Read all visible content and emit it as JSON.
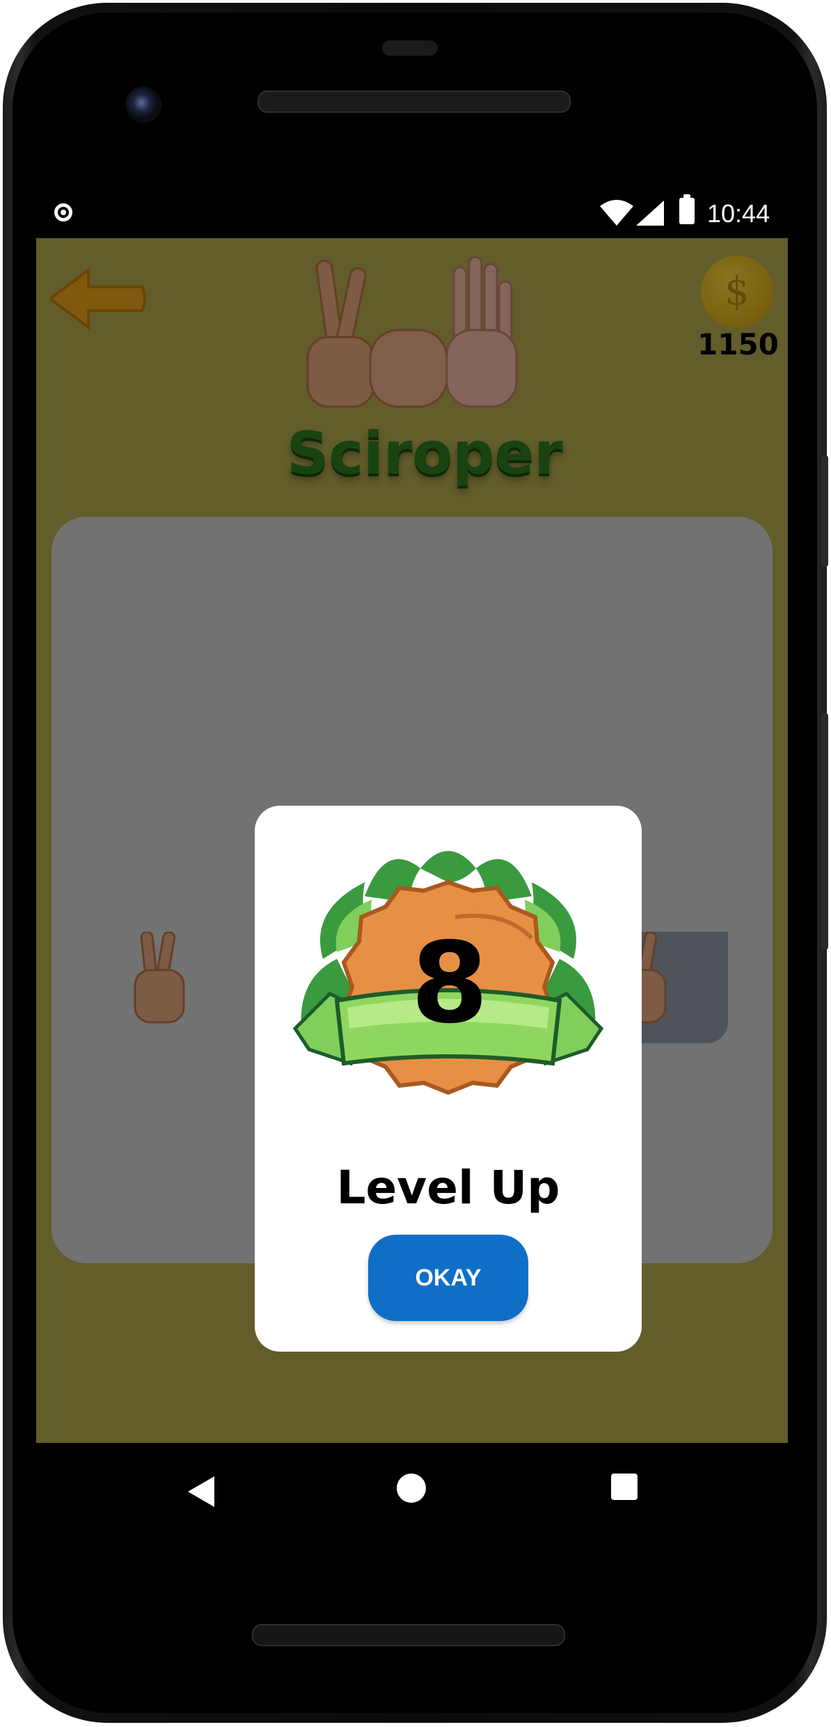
{
  "status_bar": {
    "time": "10:44"
  },
  "header": {
    "coins": "1150",
    "coin_symbol": "$",
    "app_title": "Sciroper"
  },
  "dialog": {
    "level": "8",
    "title": "Level Up",
    "button_label": "OKAY"
  },
  "colors": {
    "screen_background": "#b3a94e",
    "panel_background": "#cfcfcf",
    "accent_button": "#0f6fc6",
    "title_green": "#2f7a1e",
    "coin_gold": "#e3b720"
  },
  "icons": {
    "back": "arrow-left-icon",
    "coin": "dollar-coin-icon",
    "nav_back": "triangle-back-icon",
    "nav_home": "circle-home-icon",
    "nav_recents": "square-recents-icon"
  }
}
